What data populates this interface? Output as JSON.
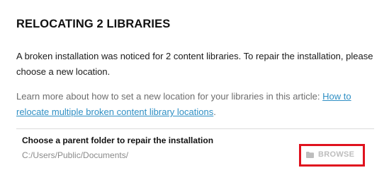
{
  "dialog": {
    "title": "RELOCATING 2 LIBRARIES",
    "message": "A broken installation was noticed for 2 content libraries. To repair the installation, please choose a new location.",
    "learn_more_prefix": "Learn more about how to set a new location for your libraries in this article: ",
    "learn_more_link": "How to relocate multiple broken content library locations",
    "learn_more_suffix": "."
  },
  "folder_picker": {
    "label": "Choose a parent folder to repair the installation",
    "path": "C:/Users/Public/Documents/",
    "browse_label": "BROWSE",
    "browse_icon": "folder-icon",
    "highlight_color": "#e0121e"
  },
  "colors": {
    "link": "#2f8fc4",
    "muted_text": "#6d6d6d",
    "disabled_button": "#bdbdbd"
  }
}
